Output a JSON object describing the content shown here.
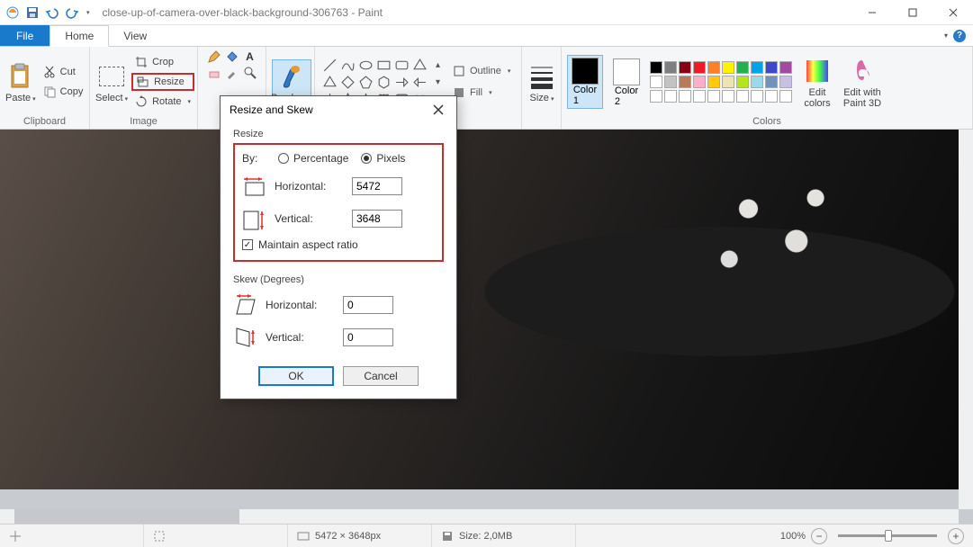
{
  "title": "close-up-of-camera-over-black-background-306763 - Paint",
  "tabs": {
    "file": "File",
    "home": "Home",
    "view": "View"
  },
  "clipboard": {
    "label": "Clipboard",
    "paste": "Paste",
    "cut": "Cut",
    "copy": "Copy"
  },
  "image": {
    "label": "Image",
    "select": "Select",
    "crop": "Crop",
    "resize": "Resize",
    "rotate": "Rotate"
  },
  "tools": {
    "brushes": "Brushes"
  },
  "shapes": {
    "outline": "Outline",
    "fill": "Fill"
  },
  "size": {
    "label": "Size"
  },
  "colors": {
    "label": "Colors",
    "color1": "Color\n1",
    "color2": "Color\n2",
    "edit": "Edit\ncolors",
    "paint3d": "Edit with\nPaint 3D"
  },
  "palette_row1": [
    "#000000",
    "#7f7f7f",
    "#880015",
    "#ed1c24",
    "#ff7f27",
    "#fff200",
    "#22b14c",
    "#00a2e8",
    "#3f48cc",
    "#a349a4"
  ],
  "palette_row2": [
    "#ffffff",
    "#c3c3c3",
    "#b97a57",
    "#ffaec9",
    "#ffc90e",
    "#efe4b0",
    "#b5e61d",
    "#99d9ea",
    "#7092be",
    "#c8bfe7"
  ],
  "dialog": {
    "title": "Resize and Skew",
    "resize_label": "Resize",
    "by": "By:",
    "percentage": "Percentage",
    "pixels": "Pixels",
    "horizontal": "Horizontal:",
    "vertical": "Vertical:",
    "h_val": "5472",
    "v_val": "3648",
    "maintain": "Maintain aspect ratio",
    "skew_label": "Skew (Degrees)",
    "skew_h": "0",
    "skew_v": "0",
    "ok": "OK",
    "cancel": "Cancel"
  },
  "status": {
    "dims": "5472 × 3648px",
    "size": "Size: 2,0MB",
    "zoom": "100%"
  }
}
